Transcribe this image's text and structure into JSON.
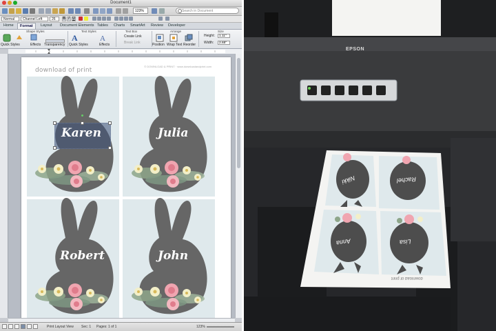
{
  "window": {
    "title": "Document1"
  },
  "toolbar": {
    "zoom": "123%",
    "search_placeholder": "Search in Document"
  },
  "format_bar": {
    "style": "Normal",
    "font": "Channel Left",
    "size": "26",
    "bold": "B",
    "italic": "I",
    "underline": "U"
  },
  "tabs": [
    {
      "label": "Home",
      "active": false
    },
    {
      "label": "Format",
      "active": true
    },
    {
      "label": "Layout",
      "active": false
    },
    {
      "label": "Document Elements",
      "active": false
    },
    {
      "label": "Tables",
      "active": false
    },
    {
      "label": "Charts",
      "active": false
    },
    {
      "label": "SmartArt",
      "active": false
    },
    {
      "label": "Review",
      "active": false
    },
    {
      "label": "Developer",
      "active": false
    }
  ],
  "ribbon": {
    "groups": {
      "shape_styles": "Shape Styles",
      "text_styles": "Text Styles",
      "text_box": "Text Box",
      "arrange": "Arrange",
      "size": "Size"
    },
    "buttons": {
      "quick_styles": "Quick Styles",
      "effects": "Effects",
      "transparency": "Transparency",
      "quick_styles_text": "Quick Styles",
      "text_effects": "Effects",
      "create_link": "Create Link",
      "break_link": "Break Link",
      "wrap_to_object": "Wrap to Object",
      "position": "Position",
      "wrap_text": "Wrap Text",
      "reorder": "Reorder",
      "height_label": "Height:",
      "height_value": "1.11\"",
      "width_label": "Width:",
      "width_value": "2.65\""
    }
  },
  "document": {
    "header_left": "download of print",
    "header_right": "© DOWNLOAD & PRINT · www.downloadandprint.com",
    "cards": [
      {
        "name": "Karen",
        "selected": true
      },
      {
        "name": "Julia",
        "selected": false
      },
      {
        "name": "Robert",
        "selected": false
      },
      {
        "name": "John",
        "selected": false
      }
    ],
    "bunny_color": "#666666",
    "card_bg": "#dfe9ec",
    "flower_pink": "#f0a5b0",
    "flower_cream": "#f3efc8"
  },
  "status": {
    "view": "Print Layout View",
    "sec": "Sec: 1",
    "pages": "Pages: 1 of 1",
    "zoom": "123%"
  },
  "photo": {
    "printer_brand": "EPSON",
    "printed_names": [
      "Nikki",
      "Rachel",
      "Anna",
      "Lisa"
    ],
    "paper_footer": "download of print"
  }
}
